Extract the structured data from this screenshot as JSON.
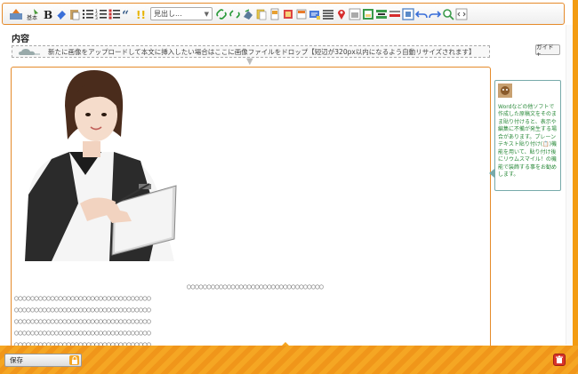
{
  "colors": {
    "accent": "#f39c12",
    "border": "#e58a2a",
    "tip_text": "#2a8a3a",
    "trash": "#d9342b"
  },
  "toolbar": {
    "icons": [
      "upload-image-icon",
      "basic-icon",
      "bold-icon",
      "eraser-icon",
      "paste-icon",
      "bullet-list-icon",
      "numbered-list-icon",
      "checklist-icon",
      "quote-icon",
      "exclamation-icon"
    ],
    "heading_select_value": "見出し...",
    "icons_after_select": [
      "link-icon",
      "unlink-icon",
      "clone-icon",
      "copy-icon",
      "page-icon",
      "book-icon",
      "card-icon",
      "news-icon",
      "map-pin-icon",
      "image-icon",
      "table-icon",
      "hr-icon",
      "red-line-icon",
      "frame-icon",
      "undo-icon",
      "redo-icon",
      "search-icon",
      "source-icon"
    ]
  },
  "section": {
    "label": "内容"
  },
  "upload_hint": {
    "text": "新たに画像をアップロードして本文に挿入したい場合はここに画像ファイルをドロップ【短辺が320px以内になるよう自動リサイズされます】"
  },
  "guide_button": {
    "label": "ガイド +"
  },
  "editor": {
    "text_lines": [
      "○○○○○○○○○○○○○○○○○○○○○○○○○○○○○○○○○○",
      "○○○○○○○○○○○○○○○○○○○○○○○○○○○○○○○○○○",
      "○○○○○○○○○○○○○○○○○○○○○○○○○○○○○○○○○○",
      "○○○○○○○○○○○○○○○○○○○○○○○○○○○○○○○○○○",
      "○○○○○○○○○○○○○○○○○○○○○○○○○○○○○○○○○○",
      "○○○○○○○○○○○○○○○○○○○○○○○○○○○○○○○○○○"
    ]
  },
  "tip": {
    "text": "Wordなどの他ソフトで作成した原稿文をそのまま貼り付けると、表示や編集に不備が発生する場合があります。プレーンテキスト貼り付け(📋)機能を用いて、貼り付け後にリウムスマイル！の機能で装飾する事をお勧めします。"
  },
  "footer": {
    "save_label": "保存"
  }
}
